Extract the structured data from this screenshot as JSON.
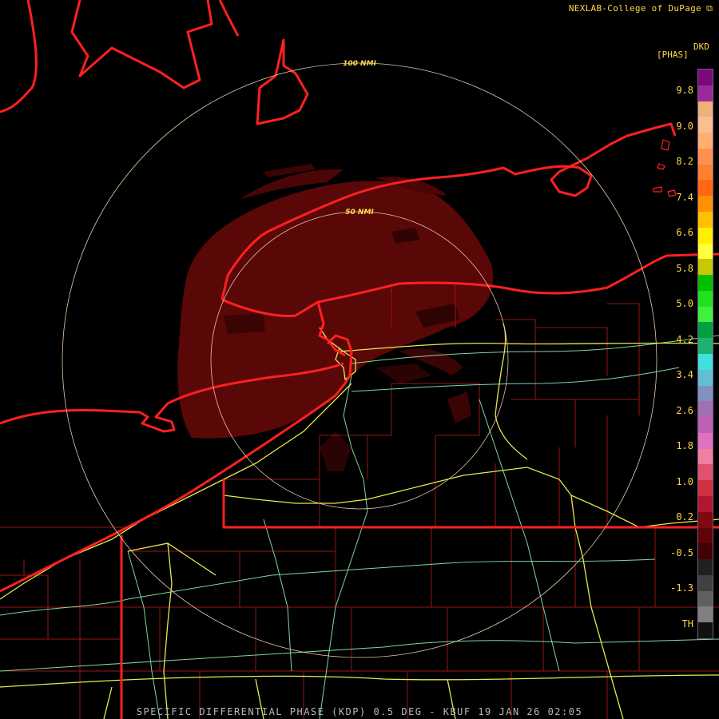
{
  "credit": "NEXLAB-College of DuPage",
  "credit_icon": "external-link-icon",
  "product_code": "DKD",
  "unit": "[PHAS]",
  "footer": "SPECIFIC DIFFERENTIAL PHASE (KDP) 0.5 DEG - KBUF 19 JAN 26 02:05",
  "range_rings": [
    "100 NMI",
    "50 NMI"
  ],
  "scale_ticks": [
    "9.8",
    "9.0",
    "8.2",
    "7.4",
    "6.6",
    "5.8",
    "5.0",
    "4.2",
    "3.4",
    "2.6",
    "1.8",
    "1.0",
    "0.2",
    "-0.5",
    "-1.3",
    "TH"
  ],
  "colors": {
    "background": "#000000",
    "echo": "#5a0708",
    "state_borders": "#ff2020",
    "county_lines": "#9a1616",
    "highways": "#e8e84a",
    "roads": "#7fd6a0",
    "range_rings": "#e8c8a8",
    "text": "#ffd84a"
  },
  "color_scale": [
    "#7a0a7a",
    "#9a2a9a",
    "#f0b07a",
    "#f8c090",
    "#ffb070",
    "#ff9050",
    "#ff8030",
    "#ff6810",
    "#ff9000",
    "#ffc000",
    "#fff000",
    "#ffff40",
    "#c8c800",
    "#00c000",
    "#20e020",
    "#40f040",
    "#00a040",
    "#20b070",
    "#40e0e0",
    "#60c0d0",
    "#8090c0",
    "#a070b0",
    "#c060b0",
    "#e070c0",
    "#f080a0",
    "#e05070",
    "#d03040",
    "#b01830",
    "#800810",
    "#600408",
    "#400204",
    "#202020",
    "#404040",
    "#606060",
    "#808080",
    "#111111"
  ]
}
